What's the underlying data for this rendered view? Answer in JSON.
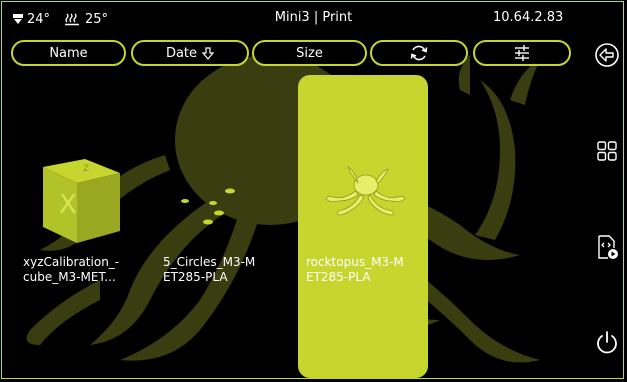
{
  "status": {
    "bed_temp": "24°",
    "nozzle_temp": "25°",
    "title": "Mini3 | Print",
    "ip": "10.64.2.83"
  },
  "sort_buttons": {
    "name": "Name",
    "date": "Date",
    "size": "Size"
  },
  "files": [
    {
      "line1": "xyzCalibration_-",
      "line2": "cube_M3-MET..."
    },
    {
      "line1": "5_Circles_M3-M",
      "line2": "ET285-PLA"
    },
    {
      "line1": "rocktopus_M3-M",
      "line2": "ET285-PLA"
    }
  ],
  "icons": {
    "bed": "bed-temp-icon",
    "heater": "heater-icon",
    "refresh": "refresh-icon",
    "filter": "filter-icon",
    "back": "back-arrow-icon",
    "grid": "grid-view-icon",
    "gcode": "gcode-file-icon",
    "power": "power-icon",
    "sort_arrow": "arrow-down-icon"
  },
  "colors": {
    "accent": "#c7d62e",
    "background": "#000000",
    "text": "#ffffff"
  }
}
